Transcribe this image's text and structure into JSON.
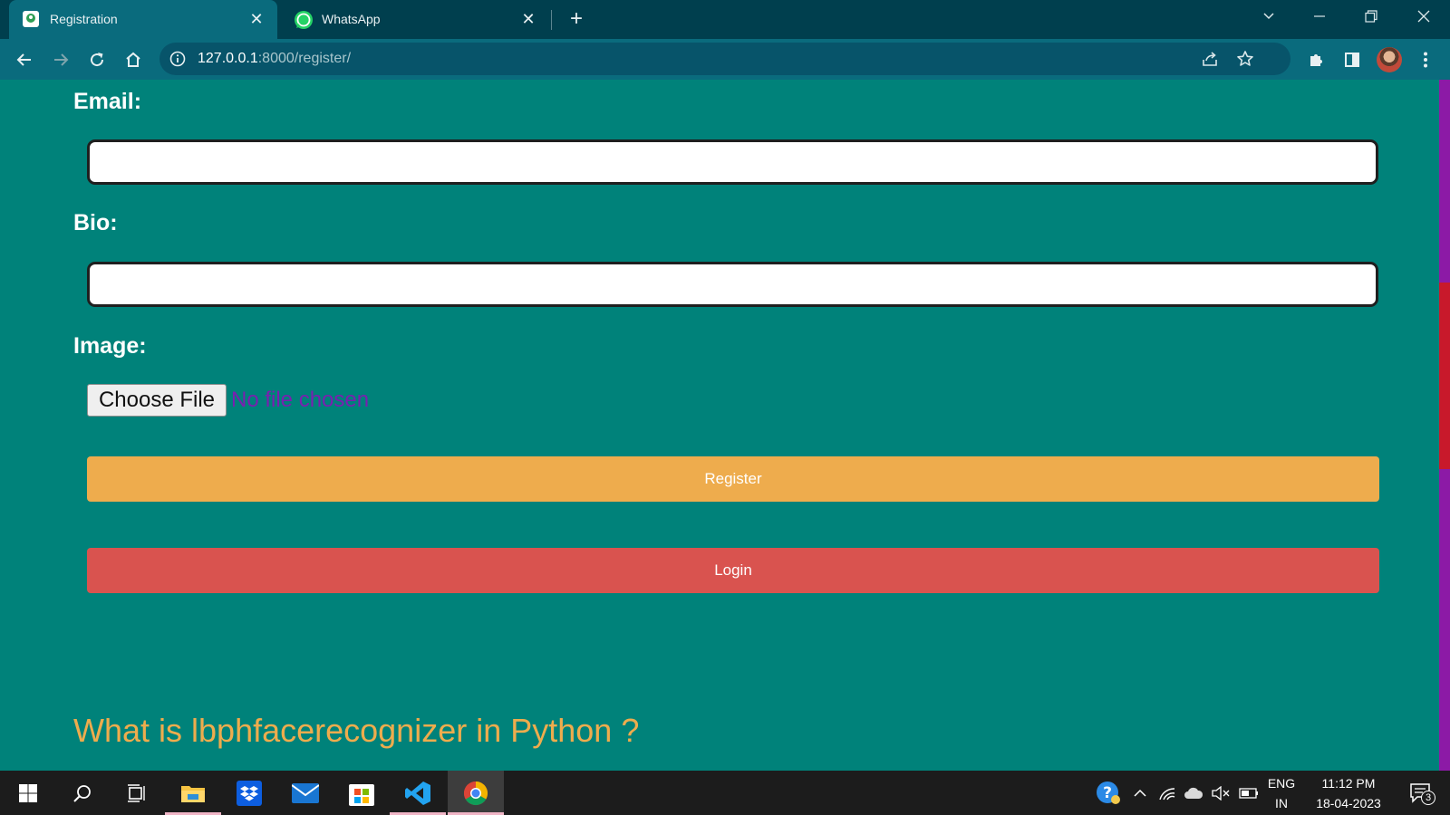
{
  "browser": {
    "tabs": [
      {
        "title": "Registration",
        "icon": "registration-favicon"
      },
      {
        "title": "WhatsApp",
        "icon": "whatsapp-favicon"
      }
    ],
    "close_glyph": "✕",
    "new_tab_glyph": "+",
    "address": {
      "host": "127.0.0.1",
      "path": ":8000/register/"
    }
  },
  "form": {
    "email_label": "Email:",
    "bio_label": "Bio:",
    "image_label": "Image:",
    "choose_file_label": "Choose File",
    "no_file_text": "No file chosen",
    "register_label": "Register",
    "login_label": "Login"
  },
  "footer_heading": "What is lbphfacerecognizer in Python ?",
  "taskbar": {
    "language_top": "ENG",
    "language_bottom": "IN",
    "time": "11:12 PM",
    "date": "18-04-2023",
    "notification_count": "3"
  },
  "colors": {
    "page_background": "#00827a",
    "register_button": "#eeac4d",
    "login_button": "#d9534f",
    "heading": "#eeac4d",
    "no_file_text": "#7a1fb0"
  }
}
